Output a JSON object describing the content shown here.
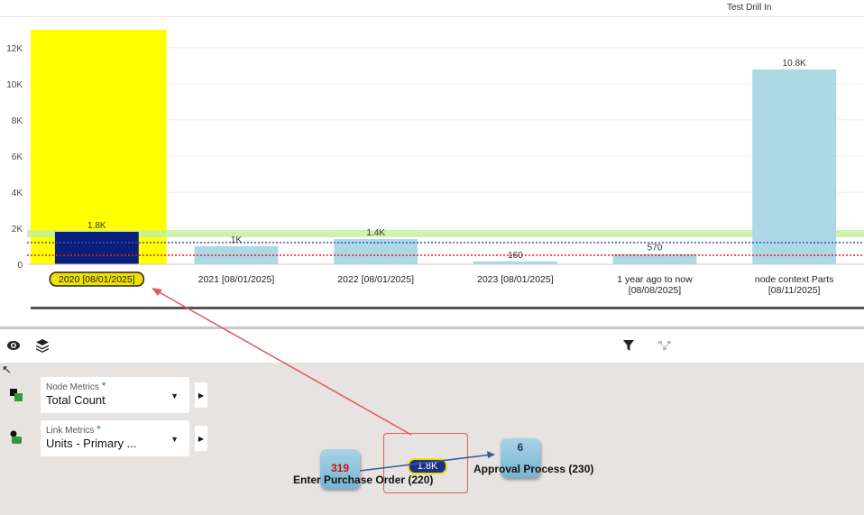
{
  "chart_header": {
    "title": "Test Drill In"
  },
  "chart_data": {
    "type": "bar",
    "categories": [
      "2020 [08/01/2025]",
      "2021 [08/01/2025]",
      "2022 [08/01/2025]",
      "2023 [08/01/2025]",
      "1 year ago to now [08/08/2025]",
      "node context Parts [08/11/2025]"
    ],
    "values": [
      1800,
      1000,
      1400,
      160,
      570,
      10800
    ],
    "value_labels": [
      "1.8K",
      "1K",
      "1.4K",
      "160",
      "570",
      "10.8K"
    ],
    "yticks": [
      "0",
      "2K",
      "4K",
      "6K",
      "8K",
      "10K",
      "12K"
    ],
    "ylim": [
      0,
      13000
    ],
    "selected_category": "2020 [08/01/2025]",
    "colors": {
      "bar": "#add8e6",
      "selected_bar": "#0a1f7a",
      "selected_band": "#ffff00",
      "reference_band": "#c6ef9c",
      "blue_line": "#3a50c8",
      "red_line": "#e02020"
    },
    "reference_band": [
      1500,
      1900
    ],
    "blue_line_value": 1200,
    "red_line_value": 500,
    "grid": true
  },
  "toolbar": {
    "icons": [
      "eye-icon",
      "layers-icon",
      "filter-icon",
      "hierarchy-icon"
    ]
  },
  "metrics": {
    "node": {
      "label": "Node Metrics",
      "required": "*",
      "value": "Total Count",
      "caret": "▼",
      "side": "▶"
    },
    "link": {
      "label": "Link Metrics",
      "required": "*",
      "value": "Units - Primary ...",
      "caret": "▼",
      "side": "▶"
    }
  },
  "panel": {
    "corner_glyph": "↖"
  },
  "process_map": {
    "nodes": [
      {
        "count": "319",
        "label": "Enter Purchase Order (220)",
        "count_color": "#d01010"
      },
      {
        "count": "6",
        "label": "Approval Process (230)",
        "count_color": "#1a3a6a"
      }
    ],
    "link_value": "1.8K"
  }
}
